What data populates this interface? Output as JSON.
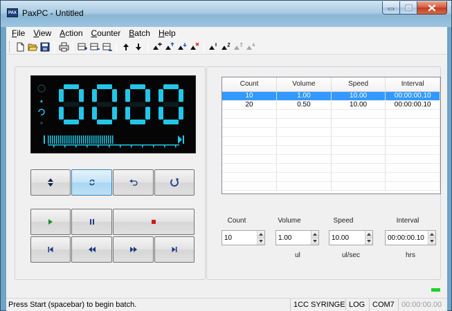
{
  "window": {
    "icon_label": "PAX",
    "title": "PaxPC - Untitled"
  },
  "menu": [
    "File",
    "View",
    "Action",
    "Counter",
    "Batch",
    "Help"
  ],
  "menu_underline": [
    "F",
    "V",
    "A",
    "C",
    "B",
    "H"
  ],
  "toolbar": {
    "icons": [
      "new-file-icon",
      "open-folder-icon",
      "save-icon",
      "print-icon",
      "insert-row-icon",
      "delete-row-icon",
      "clear-rows-icon",
      "move-up-icon",
      "move-down-icon",
      "step-insert-icon",
      "step-up-icon",
      "step-down-icon",
      "step-delete-icon",
      "step-1-icon",
      "step-2-icon",
      "step-3-icon",
      "step-4-icon"
    ]
  },
  "display": {
    "digits": "0000",
    "accent_color": "#23c6e8"
  },
  "controls": {
    "row1": [
      "direction-toggle-icon",
      "repeat-icon",
      "undo-icon",
      "reset-icon"
    ],
    "row2": [
      "play-icon",
      "pause-icon",
      "stop-icon"
    ],
    "row3": [
      "skip-back-icon",
      "rewind-icon",
      "fast-forward-icon",
      "skip-forward-icon"
    ]
  },
  "batch_table": {
    "columns": [
      "Count",
      "Volume",
      "Speed",
      "Interval"
    ],
    "rows": [
      [
        "10",
        "1.00",
        "10.00",
        "00:00:00.10"
      ],
      [
        "20",
        "0.50",
        "10.00",
        "00:00:00.10"
      ]
    ],
    "selected_row": 0
  },
  "params": {
    "count": {
      "label": "Count",
      "value": "10",
      "unit": ""
    },
    "volume": {
      "label": "Volume",
      "value": "1.00",
      "unit": "ul"
    },
    "speed": {
      "label": "Speed",
      "value": "10.00",
      "unit": "ul/sec"
    },
    "interval": {
      "label": "Interval",
      "value": "00:00:00.10",
      "unit": "hrs"
    }
  },
  "status": {
    "message": "Press Start (spacebar) to begin batch.",
    "syringe": "1CC SYRINGE",
    "log": "LOG",
    "port": "COM7",
    "timer": "00:00:00.00",
    "indicator_color": "#1cd12b"
  }
}
